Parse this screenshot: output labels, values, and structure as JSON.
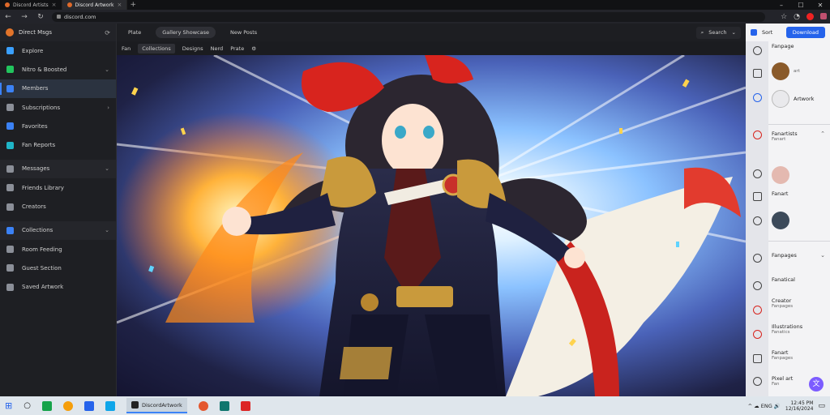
{
  "browser": {
    "tabs": [
      {
        "label": "Discord Artists"
      },
      {
        "label": "Discord Artwork"
      }
    ],
    "url": "discord.com",
    "window_controls": [
      "–",
      "☐",
      "✕"
    ]
  },
  "sidebar": {
    "header": "Direct Msgs",
    "items": [
      {
        "label": "Explore",
        "icon": "compass-icon",
        "color": "#3aa0ff"
      },
      {
        "label": "Nitro & Boosted",
        "icon": "nitro-icon",
        "color": "#22c55e",
        "chevron": "⌄"
      },
      {
        "label": "Members",
        "icon": "members-icon",
        "color": "#3b82f6",
        "selected": true
      },
      {
        "label": "Subscriptions",
        "icon": "subscriptions-icon",
        "color": "#8b8f98",
        "chevron": "›"
      },
      {
        "label": "Favorites",
        "icon": "favorites-icon",
        "color": "#3b82f6"
      },
      {
        "label": "Fan Reports",
        "icon": "fan-icon",
        "color": "#1fb5c7"
      },
      {
        "label": "Messages",
        "icon": "messages-icon",
        "color": "#8b8f98",
        "chevron": "⌄"
      },
      {
        "label": "Friends Library",
        "icon": "library-icon",
        "color": "#8b8f98"
      },
      {
        "label": "Creators",
        "icon": "creators-icon",
        "color": "#8b8f98"
      },
      {
        "label": "Collections",
        "icon": "collections-icon",
        "color": "#3b82f6",
        "chevron": "⌄"
      },
      {
        "label": "Room Feeding",
        "icon": "room-icon",
        "color": "#8b8f98"
      },
      {
        "label": "Guest Section",
        "icon": "guest-icon",
        "color": "#8b8f98"
      },
      {
        "label": "Saved Artwork",
        "icon": "saved-icon",
        "color": "#8b8f98"
      }
    ]
  },
  "toolbar": {
    "tabs": [
      "Plate",
      "Gallery Showcase",
      "New Posts"
    ],
    "right_label": "Search",
    "filters": [
      "Fan",
      "Collections",
      "Designs",
      "Nerd",
      "Prate"
    ]
  },
  "right_panel": {
    "top_label": "Sort",
    "top_button": "Download",
    "rows": [
      {
        "label": "Fanpage",
        "sub": ""
      },
      {
        "label": "",
        "sub": "art"
      },
      {
        "label": "Artwork",
        "sub": ""
      },
      {
        "label": "Fanartists",
        "sub": "Fanart"
      },
      {
        "label": "Fanart",
        "sub": ""
      },
      {
        "label": "Fanpages",
        "sub": ""
      },
      {
        "label": "Fanatical",
        "sub": ""
      },
      {
        "label": "Creator",
        "sub": "Fanpages"
      },
      {
        "label": "Illustrations",
        "sub": "Fanatics"
      },
      {
        "label": "Fanart",
        "sub": "Fanpages"
      },
      {
        "label": "Pixel art",
        "sub": "Fan"
      }
    ]
  },
  "taskbar": {
    "active_app": "DiscordArtwork",
    "tray": "^ ☁ ENG 🔊",
    "time": "12:45 PM",
    "date": "12/16/2024"
  }
}
